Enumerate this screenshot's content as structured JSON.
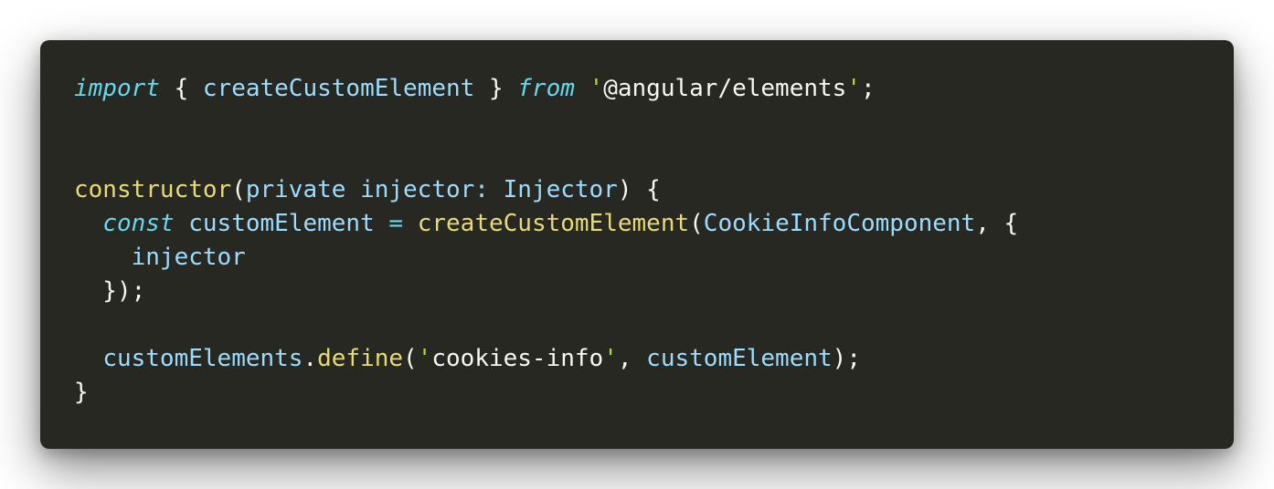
{
  "code": {
    "line1": {
      "kw_import": "import",
      "brace_open": " { ",
      "name": "createCustomElement",
      "brace_close": " } ",
      "kw_from": "from",
      "space": " ",
      "quote_open": "'",
      "module": "@angular/elements",
      "quote_close": "'",
      "semi": ";"
    },
    "line4": {
      "fn": "constructor",
      "paren_open": "(",
      "args": "private injector: Injector",
      "paren_close": ")",
      "brace": " {"
    },
    "line5": {
      "indent": "  ",
      "kw_const": "const",
      "var": " customElement ",
      "eq": "=",
      "space": " ",
      "fn": "createCustomElement",
      "paren": "(",
      "arg": "CookieInfoComponent",
      "rest": ", {"
    },
    "line6": {
      "text": "    injector"
    },
    "line7": {
      "text": "  });"
    },
    "line9": {
      "indent": "  ",
      "obj": "customElements",
      "dot": ".",
      "fn": "define",
      "paren": "(",
      "quote_open": "'",
      "str": "cookies-info",
      "quote_close": "'",
      "comma": ", ",
      "arg": "customElement",
      "end": ");"
    },
    "line10": {
      "text": "}"
    }
  }
}
